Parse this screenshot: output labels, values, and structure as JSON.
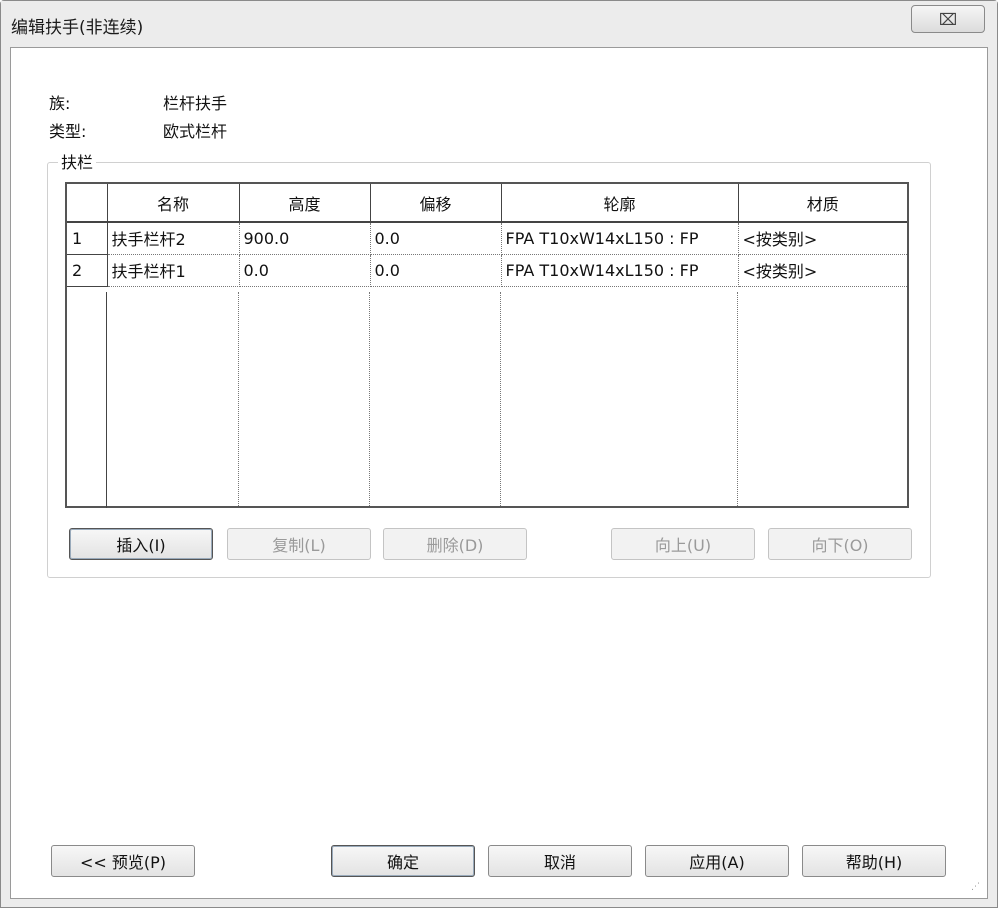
{
  "window": {
    "title": "编辑扶手(非连续)",
    "close_glyph": "⌧"
  },
  "info": {
    "family_label": "族:",
    "family_value": "栏杆扶手",
    "type_label": "类型:",
    "type_value": "欧式栏杆"
  },
  "group": {
    "legend": "扶栏"
  },
  "table": {
    "columns": [
      "名称",
      "高度",
      "偏移",
      "轮廓",
      "材质"
    ],
    "rows": [
      {
        "num": "1",
        "name": "扶手栏杆2",
        "height": "900.0",
        "offset": "0.0",
        "profile": "FPA T10xW14xL150 : FP",
        "material": "<按类别>"
      },
      {
        "num": "2",
        "name": "扶手栏杆1",
        "height": "0.0",
        "offset": "0.0",
        "profile": "FPA T10xW14xL150 : FP",
        "material": "<按类别>"
      }
    ]
  },
  "buttons": {
    "insert": "插入(I)",
    "copy": "复制(L)",
    "delete": "删除(D)",
    "up": "向上(U)",
    "down": "向下(O)",
    "preview": "<< 预览(P)",
    "ok": "确定",
    "cancel": "取消",
    "apply": "应用(A)",
    "help": "帮助(H)"
  }
}
